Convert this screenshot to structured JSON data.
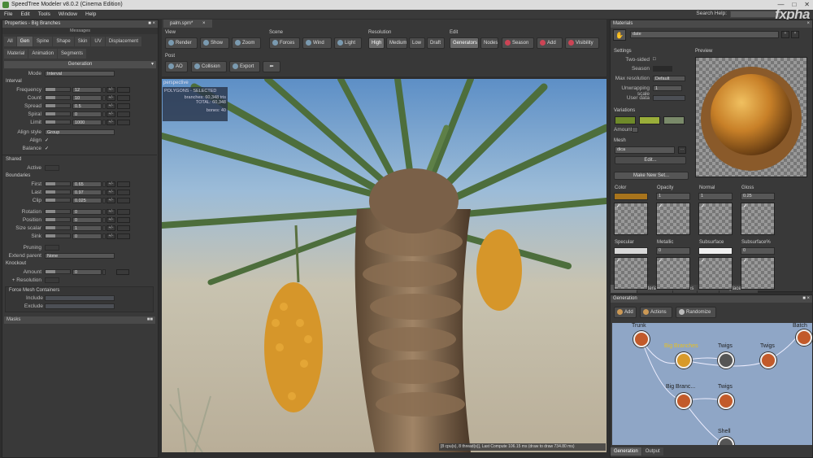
{
  "window": {
    "title": "SpeedTree Modeler v8.0.2 (Cinema Edition)",
    "logo": "fxpha"
  },
  "menu": [
    "File",
    "Edit",
    "Tools",
    "Window",
    "Help"
  ],
  "search": {
    "label": "Search Help:",
    "placeholder": ""
  },
  "properties": {
    "title": "Properties - Big Branches",
    "messages": "Messages",
    "tabs1": [
      "All",
      "Gen",
      "Spine",
      "Shape",
      "Skin",
      "UV",
      "Displacement"
    ],
    "tabs2": [
      "Material",
      "Animation",
      "Segments"
    ],
    "section": "Generation",
    "mode_label": "Mode",
    "mode_value": "Interval",
    "interval_label": "Interval",
    "interval_rows": [
      {
        "label": "Frequency",
        "value": "12"
      },
      {
        "label": "Count",
        "value": "10"
      },
      {
        "label": "Spread",
        "value": "0.5"
      },
      {
        "label": "Spiral",
        "value": "0"
      },
      {
        "label": "Limit",
        "value": "1000"
      }
    ],
    "align_style_label": "Align style",
    "align_style_value": "Group",
    "align_label": "Align",
    "balance_label": "Balance",
    "shared_label": "Shared",
    "active_label": "Active",
    "boundaries_label": "Boundaries",
    "boundary_rows": [
      {
        "label": "First",
        "value": "0.65"
      },
      {
        "label": "Last",
        "value": "0.97"
      },
      {
        "label": "Clip",
        "value": "0.025"
      }
    ],
    "shared_rows": [
      {
        "label": "Rotation",
        "value": "0"
      },
      {
        "label": "Position",
        "value": "0"
      },
      {
        "label": "Size scalar",
        "value": "1"
      },
      {
        "label": "Sink",
        "value": "0"
      }
    ],
    "pruning_label": "Pruning",
    "extend_parent_label": "Extend parent",
    "extend_parent_value": "None",
    "knockout_label": "Knockout",
    "amount_label": "Amount",
    "amount_value": "0",
    "plus_resolution_label": "+ Resolution",
    "force_mesh_label": "Force Mesh Containers",
    "include_label": "Include",
    "exclude_label": "Exclude",
    "masks_label": "Masks",
    "spin_btn": "+/-"
  },
  "viewport": {
    "file_tab": "palm.spm*",
    "groups": {
      "view": "View",
      "scene": "Scene",
      "resolution": "Resolution",
      "edit": "Edit",
      "post": "Post"
    },
    "view_buttons": [
      "Render",
      "Show",
      "Zoom"
    ],
    "scene_buttons": [
      "Forces",
      "Wind",
      "Light"
    ],
    "resolution_buttons": [
      "High",
      "Medium",
      "Low",
      "Draft"
    ],
    "edit_buttons": [
      "Generators",
      "Nodes",
      "Season",
      "Add",
      "Visibility"
    ],
    "post_buttons": [
      "AO",
      "Collision",
      "Export"
    ],
    "perspective": "perspective",
    "stats_title": "POLYGONS - SELECTED",
    "stats": [
      {
        "label": "branches:",
        "value": "60,348 tris"
      },
      {
        "label": "TOTAL:",
        "value": "60,348"
      },
      {
        "label": "bones:",
        "value": "40"
      }
    ],
    "status": "[8 cpu(s), 8 thread(s)], Last Compute 106.15 ms (draw to draw 734.80 ms)"
  },
  "materials": {
    "title": "Materials",
    "name_value": "date",
    "settings_label": "Settings",
    "preview_label": "Preview",
    "two_sided": "Two-sided",
    "season": "Season",
    "max_resolution": "Max resolution",
    "max_resolution_value": "Default",
    "unwrapping_scale": "Unwrapping scale",
    "unwrapping_scale_value": "1",
    "user_data": "User data",
    "variations_label": "Variations",
    "amount_label": "Amount",
    "mesh_label": "Mesh",
    "mesh_value": "dica",
    "edit_button": "Edit...",
    "make_new_set": "Make New Set...",
    "maps_row1": [
      {
        "label": "Color",
        "value": ""
      },
      {
        "label": "Opacity",
        "value": "1"
      },
      {
        "label": "Normal",
        "value": "1"
      },
      {
        "label": "Gloss",
        "value": "0.25"
      }
    ],
    "maps_row2": [
      {
        "label": "Specular",
        "value": ""
      },
      {
        "label": "Metallic",
        "value": "0"
      },
      {
        "label": "Subsurface",
        "value": ""
      },
      {
        "label": "Subsurface%",
        "value": "0"
      }
    ],
    "bottom_tabs": [
      "Materials",
      "Material Sets",
      "Meshes",
      "Masks",
      "Displacements"
    ],
    "colors": {
      "color_swatch": "#a8741c",
      "var1": "#6f8a2a",
      "var2": "#9aae3a",
      "var3": "#7a8a6a",
      "specular": "#d8d8d8",
      "subsurface": "#f0f0f0"
    }
  },
  "generation": {
    "title": "Generation",
    "add_button": "Add",
    "actions_button": "Actions",
    "randomize_button": "Randomize",
    "nodes": [
      {
        "label": "Trunk",
        "highlight": false
      },
      {
        "label": "Big Branches",
        "highlight": true
      },
      {
        "label": "Twigs",
        "highlight": false
      },
      {
        "label": "Twigs",
        "highlight": false
      },
      {
        "label": "Big Branc...",
        "highlight": false
      },
      {
        "label": "Twigs",
        "highlight": false
      },
      {
        "label": "Batch",
        "highlight": false
      },
      {
        "label": "Shell",
        "highlight": false
      }
    ],
    "bottom_tabs": [
      "Generation",
      "Output"
    ]
  }
}
